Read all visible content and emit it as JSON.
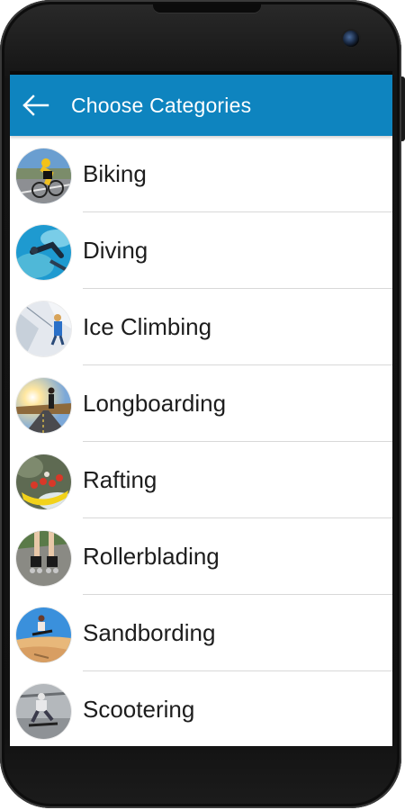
{
  "app_bar": {
    "title": "Choose Categories",
    "color": "#0e84bf"
  },
  "icons": {
    "back": "arrow-left-icon"
  },
  "categories": [
    {
      "label": "Biking",
      "avatar": "biking-photo"
    },
    {
      "label": "Diving",
      "avatar": "diving-photo"
    },
    {
      "label": "Ice Climbing",
      "avatar": "ice-climbing-photo"
    },
    {
      "label": "Longboarding",
      "avatar": "longboarding-photo"
    },
    {
      "label": "Rafting",
      "avatar": "rafting-photo"
    },
    {
      "label": "Rollerblading",
      "avatar": "rollerblading-photo"
    },
    {
      "label": "Sandbording",
      "avatar": "sandboarding-photo"
    },
    {
      "label": "Scootering",
      "avatar": "scootering-photo"
    }
  ]
}
